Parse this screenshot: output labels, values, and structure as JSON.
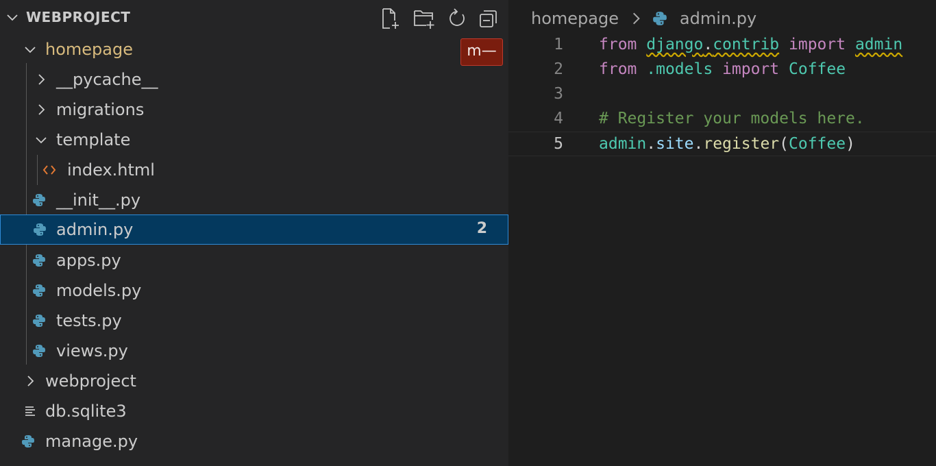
{
  "explorer": {
    "title": "WEBPROJECT",
    "actions": [
      {
        "name": "new-file-icon"
      },
      {
        "name": "new-folder-icon"
      },
      {
        "name": "refresh-icon"
      },
      {
        "name": "collapse-all-icon"
      }
    ],
    "modified_badge": "m—",
    "items": [
      {
        "label": "homepage",
        "type": "folder",
        "state": "expanded"
      },
      {
        "label": "__pycache__",
        "type": "folder",
        "state": "collapsed"
      },
      {
        "label": "migrations",
        "type": "folder",
        "state": "collapsed"
      },
      {
        "label": "template",
        "type": "folder",
        "state": "expanded"
      },
      {
        "label": "index.html",
        "type": "html-file"
      },
      {
        "label": "__init__.py",
        "type": "python-file"
      },
      {
        "label": "admin.py",
        "type": "python-file",
        "selected": true,
        "problems": "2"
      },
      {
        "label": "apps.py",
        "type": "python-file"
      },
      {
        "label": "models.py",
        "type": "python-file"
      },
      {
        "label": "tests.py",
        "type": "python-file"
      },
      {
        "label": "views.py",
        "type": "python-file"
      },
      {
        "label": "webproject",
        "type": "folder",
        "state": "collapsed"
      },
      {
        "label": "db.sqlite3",
        "type": "text-file"
      },
      {
        "label": "manage.py",
        "type": "python-file"
      }
    ]
  },
  "editor": {
    "breadcrumb": [
      "homepage",
      "admin.py"
    ],
    "lines": [
      {
        "number": "1",
        "tokens": [
          "from",
          "django",
          ".",
          "contrib",
          "import",
          "admin"
        ]
      },
      {
        "number": "2",
        "tokens": [
          "from",
          ".models",
          "import",
          "Coffee"
        ]
      },
      {
        "number": "3",
        "tokens": []
      },
      {
        "number": "4",
        "tokens": [
          "# Register your models here."
        ]
      },
      {
        "number": "5",
        "tokens": [
          "admin",
          ".",
          "site",
          ".",
          "register",
          "(",
          "Coffee",
          ")"
        ]
      }
    ],
    "active_line": "5"
  },
  "colors": {
    "sidebar_bg": "#252526",
    "editor_bg": "#1e1e1e",
    "selection_bg": "#04395e",
    "selection_border": "#2f8bd8",
    "modified_folder": "#d7ba7d",
    "keyword": "#c586c0",
    "module": "#4ec9b0",
    "comment": "#6a9955",
    "python_icon": "#519aba",
    "html_icon": "#e37933"
  }
}
